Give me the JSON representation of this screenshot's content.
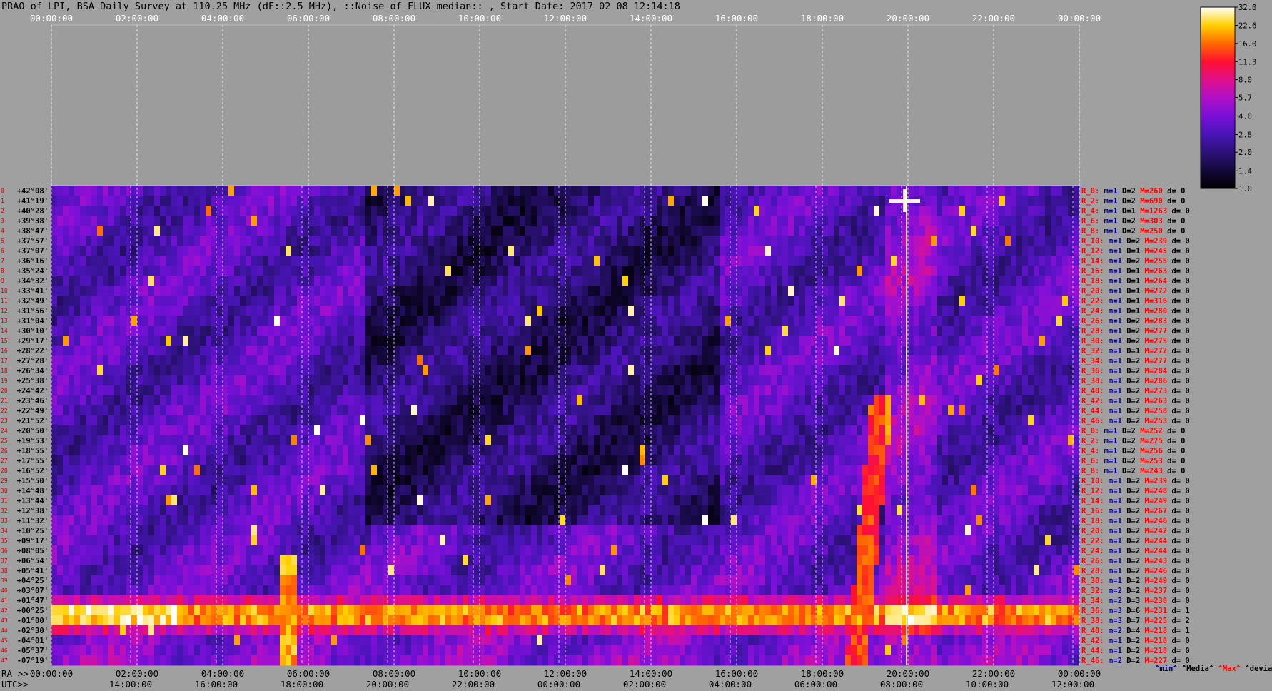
{
  "title": "PRAO of LPI, BSA Daily Survey at 110.25 MHz (dF::2.5 MHz), ::Noise_of_FLUX_median:: , Start Date: 2017 02 08 12:14:18",
  "chart_data": {
    "type": "heatmap",
    "title": "PRAO of LPI, BSA Daily Survey at 110.25 MHz (dF::2.5 MHz), ::Noise_of_FLUX_median:: , Start Date: 2017 02 08 12:14:18",
    "x_ra_ticks": [
      "00:00:00",
      "02:00:00",
      "04:00:00",
      "06:00:00",
      "08:00:00",
      "10:00:00",
      "12:00:00",
      "14:00:00",
      "16:00:00",
      "18:00:00",
      "20:00:00",
      "22:00:00",
      "00:00:00"
    ],
    "x_utc_ticks": [
      "14:00:00",
      "16:00:00",
      "18:00:00",
      "20:00:00",
      "22:00:00",
      "00:00:00",
      "02:00:00",
      "04:00:00",
      "06:00:00",
      "08:00:00",
      "10:00:00",
      "12:00:00"
    ],
    "x_ra_label": "RA >>",
    "x_utc_label": "UTC>>",
    "y_dec_labels": [
      "+42°08'",
      "+41°19'",
      "+40°28'",
      "+39°38'",
      "+38°47'",
      "+37°57'",
      "+37°07'",
      "+36°16'",
      "+35°24'",
      "+34°32'",
      "+33°41'",
      "+32°49'",
      "+31°56'",
      "+31°04'",
      "+30°10'",
      "+29°17'",
      "+28°22'",
      "+27°28'",
      "+26°34'",
      "+25°38'",
      "+24°42'",
      "+23°46'",
      "+22°49'",
      "+21°52'",
      "+20°50'",
      "+19°53'",
      "+18°55'",
      "+17°55'",
      "+16°52'",
      "+15°50'",
      "+14°48'",
      "+13°44'",
      "+12°38'",
      "+11°32'",
      "+10°25'",
      "+09°17'",
      "+08°05'",
      "+06°54'",
      "+05°41'",
      "+04°25'",
      "+03°07'",
      "+01°47'",
      "+00°25'",
      "-01°00'",
      "-02°30'",
      "-04°01'",
      "-05°37'",
      "-07°19'"
    ],
    "row_index_labels": [
      "0",
      "1",
      "2",
      "3",
      "4",
      "5",
      "6",
      "7",
      "8",
      "9",
      "10",
      "11",
      "12",
      "13",
      "14",
      "15",
      "16",
      "17",
      "18",
      "19",
      "20",
      "21",
      "22",
      "23",
      "24",
      "25",
      "26",
      "27",
      "28",
      "29",
      "30",
      "31",
      "32",
      "33",
      "34",
      "35",
      "36",
      "37",
      "38",
      "39",
      "40",
      "41",
      "42",
      "43",
      "44",
      "45",
      "46",
      "47"
    ],
    "row_stats": [
      {
        "r": "R_0:",
        "min": "m=1",
        "d": "D=2",
        "max": "M=260",
        "dev": "d= 0"
      },
      {
        "r": "R_2:",
        "min": "m=1",
        "d": "D=2",
        "max": "M=690",
        "dev": "d= 0"
      },
      {
        "r": "R_4:",
        "min": "m=1",
        "d": "D=1",
        "max": "M=1263",
        "dev": "d= 0"
      },
      {
        "r": "R_6:",
        "min": "m=1",
        "d": "D=2",
        "max": "M=303",
        "dev": "d= 0"
      },
      {
        "r": "R_8:",
        "min": "m=1",
        "d": "D=2",
        "max": "M=250",
        "dev": "d= 0"
      },
      {
        "r": "R_10:",
        "min": "m=1",
        "d": "D=2",
        "max": "M=239",
        "dev": "d= 0"
      },
      {
        "r": "R_12:",
        "min": "m=1",
        "d": "D=1",
        "max": "M=245",
        "dev": "d= 0"
      },
      {
        "r": "R_14:",
        "min": "m=1",
        "d": "D=2",
        "max": "M=255",
        "dev": "d= 0"
      },
      {
        "r": "R_16:",
        "min": "m=1",
        "d": "D=1",
        "max": "M=263",
        "dev": "d= 0"
      },
      {
        "r": "R_18:",
        "min": "m=1",
        "d": "D=1",
        "max": "M=264",
        "dev": "d= 0"
      },
      {
        "r": "R_20:",
        "min": "m=1",
        "d": "D=1",
        "max": "M=272",
        "dev": "d= 0"
      },
      {
        "r": "R_22:",
        "min": "m=1",
        "d": "D=1",
        "max": "M=316",
        "dev": "d= 0"
      },
      {
        "r": "R_24:",
        "min": "m=1",
        "d": "D=1",
        "max": "M=280",
        "dev": "d= 0"
      },
      {
        "r": "R_26:",
        "min": "m=1",
        "d": "D=2",
        "max": "M=283",
        "dev": "d= 0"
      },
      {
        "r": "R_28:",
        "min": "m=1",
        "d": "D=2",
        "max": "M=277",
        "dev": "d= 0"
      },
      {
        "r": "R_30:",
        "min": "m=1",
        "d": "D=2",
        "max": "M=275",
        "dev": "d= 0"
      },
      {
        "r": "R_32:",
        "min": "m=1",
        "d": "D=1",
        "max": "M=272",
        "dev": "d= 0"
      },
      {
        "r": "R_34:",
        "min": "m=1",
        "d": "D=2",
        "max": "M=277",
        "dev": "d= 0"
      },
      {
        "r": "R_36:",
        "min": "m=1",
        "d": "D=2",
        "max": "M=284",
        "dev": "d= 0"
      },
      {
        "r": "R_38:",
        "min": "m=1",
        "d": "D=2",
        "max": "M=286",
        "dev": "d= 0"
      },
      {
        "r": "R_40:",
        "min": "m=1",
        "d": "D=2",
        "max": "M=273",
        "dev": "d= 0"
      },
      {
        "r": "R_42:",
        "min": "m=1",
        "d": "D=2",
        "max": "M=263",
        "dev": "d= 0"
      },
      {
        "r": "R_44:",
        "min": "m=1",
        "d": "D=2",
        "max": "M=258",
        "dev": "d= 0"
      },
      {
        "r": "R_46:",
        "min": "m=1",
        "d": "D=2",
        "max": "M=253",
        "dev": "d= 0"
      },
      {
        "r": "R_0:",
        "min": "m=1",
        "d": "D=2",
        "max": "M=252",
        "dev": "d= 0"
      },
      {
        "r": "R_2:",
        "min": "m=1",
        "d": "D=2",
        "max": "M=275",
        "dev": "d= 0"
      },
      {
        "r": "R_4:",
        "min": "m=1",
        "d": "D=2",
        "max": "M=256",
        "dev": "d= 0"
      },
      {
        "r": "R_6:",
        "min": "m=1",
        "d": "D=2",
        "max": "M=253",
        "dev": "d= 0"
      },
      {
        "r": "R_8:",
        "min": "m=1",
        "d": "D=2",
        "max": "M=243",
        "dev": "d= 0"
      },
      {
        "r": "R_10:",
        "min": "m=1",
        "d": "D=2",
        "max": "M=239",
        "dev": "d= 0"
      },
      {
        "r": "R_12:",
        "min": "m=1",
        "d": "D=2",
        "max": "M=248",
        "dev": "d= 0"
      },
      {
        "r": "R_14:",
        "min": "m=1",
        "d": "D=2",
        "max": "M=249",
        "dev": "d= 0"
      },
      {
        "r": "R_16:",
        "min": "m=1",
        "d": "D=2",
        "max": "M=267",
        "dev": "d= 0"
      },
      {
        "r": "R_18:",
        "min": "m=1",
        "d": "D=2",
        "max": "M=246",
        "dev": "d= 0"
      },
      {
        "r": "R_20:",
        "min": "m=1",
        "d": "D=2",
        "max": "M=242",
        "dev": "d= 0"
      },
      {
        "r": "R_22:",
        "min": "m=1",
        "d": "D=2",
        "max": "M=244",
        "dev": "d= 0"
      },
      {
        "r": "R_24:",
        "min": "m=1",
        "d": "D=2",
        "max": "M=244",
        "dev": "d= 0"
      },
      {
        "r": "R_26:",
        "min": "m=1",
        "d": "D=2",
        "max": "M=243",
        "dev": "d= 0"
      },
      {
        "r": "R_28:",
        "min": "m=1",
        "d": "D=2",
        "max": "M=246",
        "dev": "d= 0"
      },
      {
        "r": "R_30:",
        "min": "m=1",
        "d": "D=2",
        "max": "M=249",
        "dev": "d= 0"
      },
      {
        "r": "R_32:",
        "min": "m=2",
        "d": "D=2",
        "max": "M=237",
        "dev": "d= 0"
      },
      {
        "r": "R_34:",
        "min": "m=2",
        "d": "D=3",
        "max": "M=238",
        "dev": "d= 0"
      },
      {
        "r": "R_36:",
        "min": "m=3",
        "d": "D=6",
        "max": "M=231",
        "dev": "d= 1"
      },
      {
        "r": "R_38:",
        "min": "m=3",
        "d": "D=7",
        "max": "M=225",
        "dev": "d= 2"
      },
      {
        "r": "R_40:",
        "min": "m=2",
        "d": "D=4",
        "max": "M=218",
        "dev": "d= 1"
      },
      {
        "r": "R_42:",
        "min": "m=1",
        "d": "D=2",
        "max": "M=218",
        "dev": "d= 0"
      },
      {
        "r": "R_44:",
        "min": "m=1",
        "d": "D=2",
        "max": "M=218",
        "dev": "d= 0"
      },
      {
        "r": "R_46:",
        "min": "m=2",
        "d": "D=2",
        "max": "M=227",
        "dev": "d= 0"
      }
    ],
    "stats_legend": [
      "^min^",
      "^Media^",
      "^Max^",
      "^devia^"
    ],
    "colorbar_ticks": [
      "32.0",
      "22.6",
      "16.0",
      "11.3",
      "8.0",
      "5.7",
      "4.0",
      "2.8",
      "2.0",
      "1.4",
      "1.0"
    ],
    "colorbar_range": [
      1.0,
      32.0
    ],
    "colorbar_scale": "log",
    "colors": {
      "min_text": "#000080",
      "media_text": "#000000",
      "max_text": "#ff0000",
      "rowlabel_text": "#ff0000",
      "background": "#a0a0a0"
    }
  }
}
